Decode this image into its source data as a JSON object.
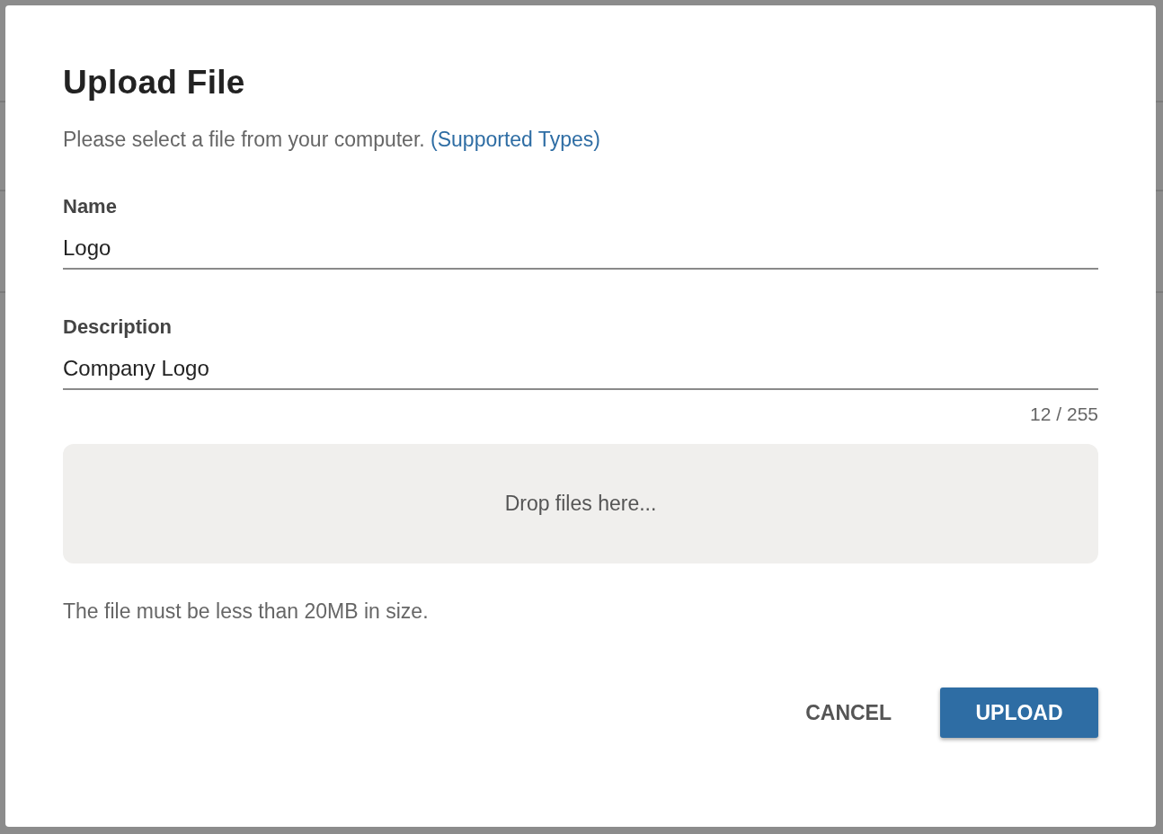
{
  "dialog": {
    "title": "Upload File",
    "intro": "Please select a file from your computer.",
    "intro_link": "(Supported Types)",
    "fields": [
      {
        "label": "Name",
        "value": "Logo"
      },
      {
        "label": "Description",
        "value": "Company Logo",
        "counter": "12 / 255"
      }
    ],
    "dropzone": {
      "text": "Drop files here..."
    },
    "note": "The file must be less than 20MB in size.",
    "buttons": [
      {
        "label": "CANCEL",
        "kind": "text"
      },
      {
        "label": "UPLOAD",
        "kind": "primary"
      }
    ]
  }
}
